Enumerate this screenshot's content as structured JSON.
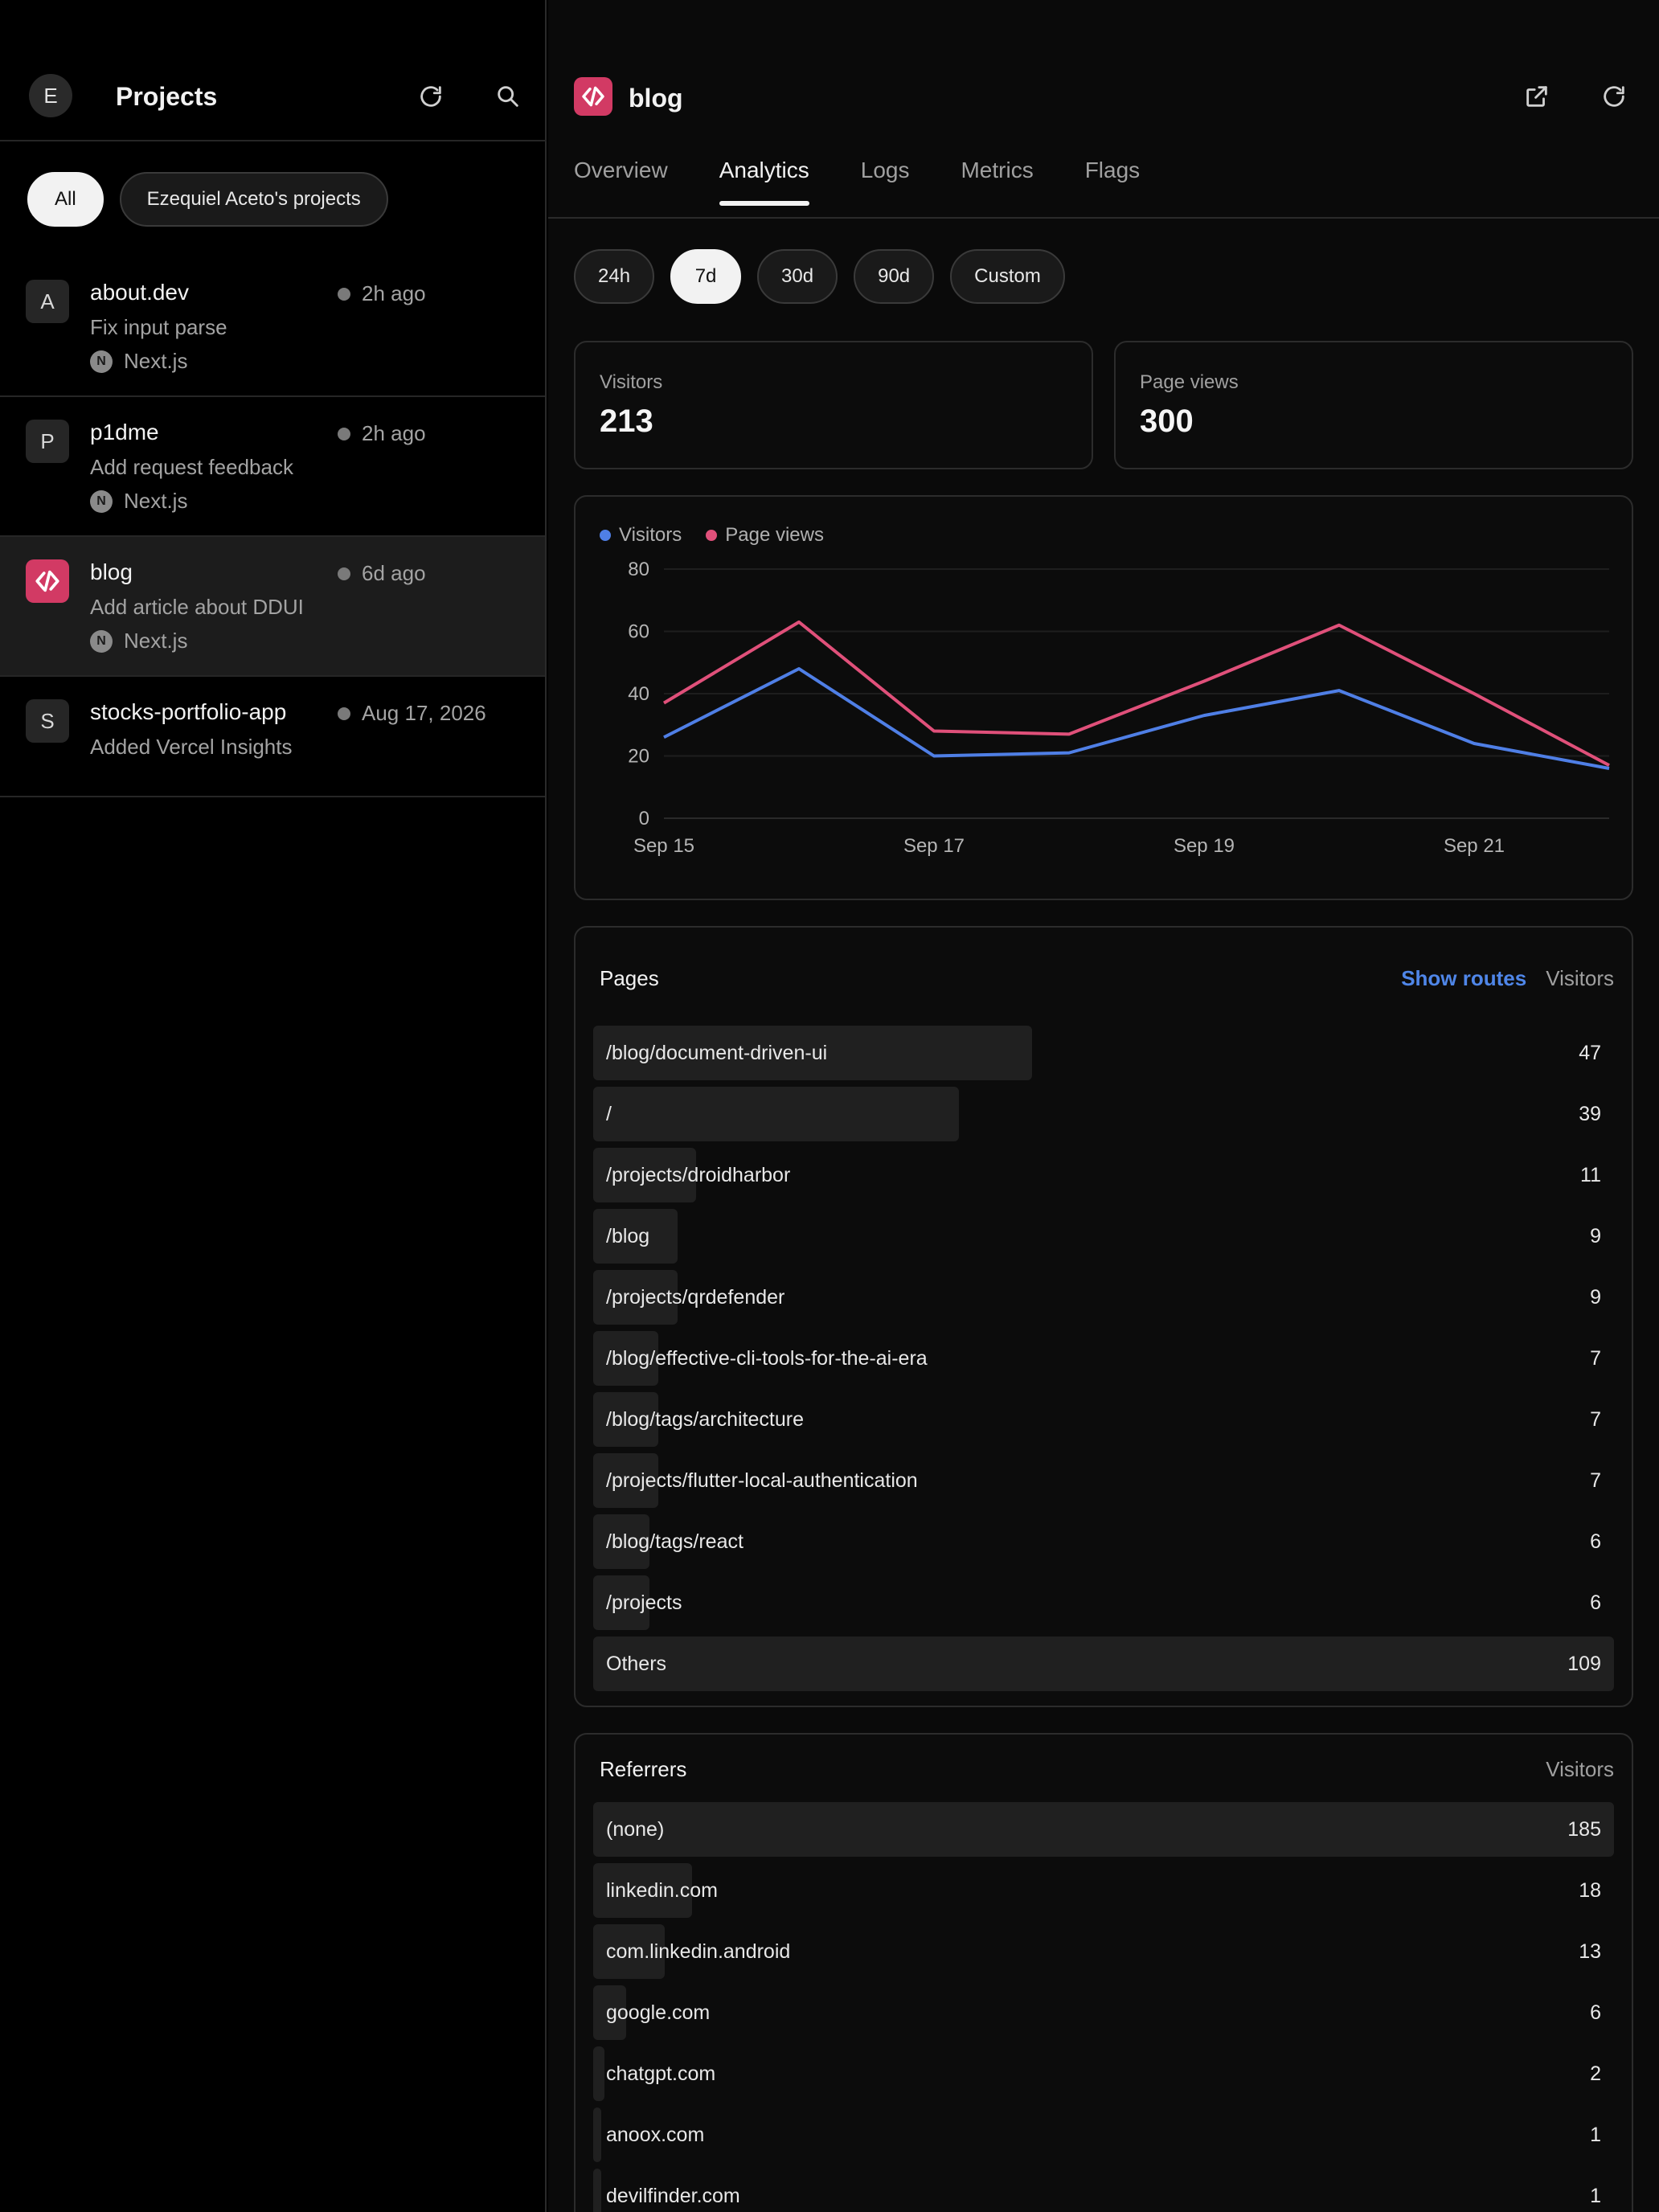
{
  "sidebar": {
    "avatar_letter": "E",
    "title": "Projects",
    "filters": [
      {
        "label": "All",
        "active": true
      },
      {
        "label": "Ezequiel Aceto's projects",
        "active": false
      }
    ],
    "projects": [
      {
        "initial": "A",
        "name": "about.dev",
        "time": "2h ago",
        "commit": "Fix input parse",
        "framework": "Next.js",
        "framework_initial": "N"
      },
      {
        "initial": "P",
        "name": "p1dme",
        "time": "2h ago",
        "commit": "Add request feedback",
        "framework": "Next.js",
        "framework_initial": "N"
      },
      {
        "initial": "",
        "name": "blog",
        "time": "6d ago",
        "commit": "Add article about DDUI",
        "framework": "Next.js",
        "framework_initial": "N",
        "selected": true
      },
      {
        "initial": "S",
        "name": "stocks-portfolio-app",
        "time": "Aug 17, 2026",
        "commit": "Added Vercel Insights"
      }
    ]
  },
  "project": {
    "name": "blog",
    "brand_color": "#d23a64"
  },
  "tabs": [
    "Overview",
    "Analytics",
    "Logs",
    "Metrics",
    "Flags"
  ],
  "active_tab": "Analytics",
  "ranges": [
    "24h",
    "7d",
    "30d",
    "90d",
    "Custom"
  ],
  "active_range": "7d",
  "stats": {
    "visitors_label": "Visitors",
    "visitors_value": "213",
    "pageviews_label": "Page views",
    "pageviews_value": "300"
  },
  "chart_data": {
    "type": "line",
    "x": [
      "Sep 15",
      "Sep 16",
      "Sep 17",
      "Sep 18",
      "Sep 19",
      "Sep 20",
      "Sep 21",
      "Sep 22"
    ],
    "x_ticks": [
      "Sep 15",
      "Sep 17",
      "Sep 19",
      "Sep 21"
    ],
    "y_ticks": [
      "0",
      "20",
      "40",
      "60",
      "80"
    ],
    "ylim": [
      0,
      80
    ],
    "grid": true,
    "legend_position": "top-left",
    "series": [
      {
        "name": "Visitors",
        "color": "#4f7fe6",
        "values": [
          26,
          48,
          20,
          21,
          33,
          41,
          24,
          16
        ]
      },
      {
        "name": "Page views",
        "color": "#e0507a",
        "values": [
          37,
          63,
          28,
          27,
          44,
          62,
          40,
          17
        ]
      }
    ]
  },
  "pages": {
    "title": "Pages",
    "show_routes": "Show routes",
    "column": "Visitors",
    "rows": [
      {
        "label": "/blog/document-driven-ui",
        "value": "47",
        "fraction": 0.43
      },
      {
        "label": "/",
        "value": "39",
        "fraction": 0.358
      },
      {
        "label": "/projects/droidharbor",
        "value": "11",
        "fraction": 0.101
      },
      {
        "label": "/blog",
        "value": "9",
        "fraction": 0.083
      },
      {
        "label": "/projects/qrdefender",
        "value": "9",
        "fraction": 0.083
      },
      {
        "label": "/blog/effective-cli-tools-for-the-ai-era",
        "value": "7",
        "fraction": 0.064
      },
      {
        "label": "/blog/tags/architecture",
        "value": "7",
        "fraction": 0.064
      },
      {
        "label": "/projects/flutter-local-authentication",
        "value": "7",
        "fraction": 0.064
      },
      {
        "label": "/blog/tags/react",
        "value": "6",
        "fraction": 0.055
      },
      {
        "label": "/projects",
        "value": "6",
        "fraction": 0.055
      },
      {
        "label": "Others",
        "value": "109",
        "fraction": 1.0
      }
    ]
  },
  "referrers": {
    "title": "Referrers",
    "column": "Visitors",
    "rows": [
      {
        "label": "(none)",
        "value": "185",
        "fraction": 1.0
      },
      {
        "label": "linkedin.com",
        "value": "18",
        "fraction": 0.097
      },
      {
        "label": "com.linkedin.android",
        "value": "13",
        "fraction": 0.07
      },
      {
        "label": "google.com",
        "value": "6",
        "fraction": 0.032
      },
      {
        "label": "chatgpt.com",
        "value": "2",
        "fraction": 0.011
      },
      {
        "label": "anoox.com",
        "value": "1",
        "fraction": 0.005
      },
      {
        "label": "devilfinder.com",
        "value": "1",
        "fraction": 0.005
      }
    ]
  }
}
